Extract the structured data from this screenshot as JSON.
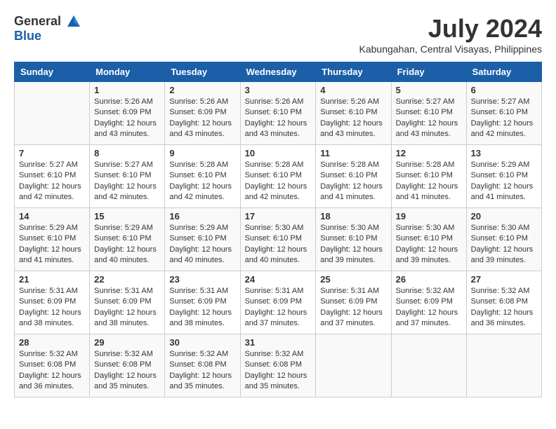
{
  "header": {
    "logo_general": "General",
    "logo_blue": "Blue",
    "title": "July 2024",
    "subtitle": "Kabungahan, Central Visayas, Philippines"
  },
  "calendar": {
    "days_of_week": [
      "Sunday",
      "Monday",
      "Tuesday",
      "Wednesday",
      "Thursday",
      "Friday",
      "Saturday"
    ],
    "weeks": [
      [
        {
          "day": "",
          "sunrise": "",
          "sunset": "",
          "daylight": ""
        },
        {
          "day": "1",
          "sunrise": "Sunrise: 5:26 AM",
          "sunset": "Sunset: 6:09 PM",
          "daylight": "Daylight: 12 hours and 43 minutes."
        },
        {
          "day": "2",
          "sunrise": "Sunrise: 5:26 AM",
          "sunset": "Sunset: 6:09 PM",
          "daylight": "Daylight: 12 hours and 43 minutes."
        },
        {
          "day": "3",
          "sunrise": "Sunrise: 5:26 AM",
          "sunset": "Sunset: 6:10 PM",
          "daylight": "Daylight: 12 hours and 43 minutes."
        },
        {
          "day": "4",
          "sunrise": "Sunrise: 5:26 AM",
          "sunset": "Sunset: 6:10 PM",
          "daylight": "Daylight: 12 hours and 43 minutes."
        },
        {
          "day": "5",
          "sunrise": "Sunrise: 5:27 AM",
          "sunset": "Sunset: 6:10 PM",
          "daylight": "Daylight: 12 hours and 43 minutes."
        },
        {
          "day": "6",
          "sunrise": "Sunrise: 5:27 AM",
          "sunset": "Sunset: 6:10 PM",
          "daylight": "Daylight: 12 hours and 42 minutes."
        }
      ],
      [
        {
          "day": "7",
          "sunrise": "Sunrise: 5:27 AM",
          "sunset": "Sunset: 6:10 PM",
          "daylight": "Daylight: 12 hours and 42 minutes."
        },
        {
          "day": "8",
          "sunrise": "Sunrise: 5:27 AM",
          "sunset": "Sunset: 6:10 PM",
          "daylight": "Daylight: 12 hours and 42 minutes."
        },
        {
          "day": "9",
          "sunrise": "Sunrise: 5:28 AM",
          "sunset": "Sunset: 6:10 PM",
          "daylight": "Daylight: 12 hours and 42 minutes."
        },
        {
          "day": "10",
          "sunrise": "Sunrise: 5:28 AM",
          "sunset": "Sunset: 6:10 PM",
          "daylight": "Daylight: 12 hours and 42 minutes."
        },
        {
          "day": "11",
          "sunrise": "Sunrise: 5:28 AM",
          "sunset": "Sunset: 6:10 PM",
          "daylight": "Daylight: 12 hours and 41 minutes."
        },
        {
          "day": "12",
          "sunrise": "Sunrise: 5:28 AM",
          "sunset": "Sunset: 6:10 PM",
          "daylight": "Daylight: 12 hours and 41 minutes."
        },
        {
          "day": "13",
          "sunrise": "Sunrise: 5:29 AM",
          "sunset": "Sunset: 6:10 PM",
          "daylight": "Daylight: 12 hours and 41 minutes."
        }
      ],
      [
        {
          "day": "14",
          "sunrise": "Sunrise: 5:29 AM",
          "sunset": "Sunset: 6:10 PM",
          "daylight": "Daylight: 12 hours and 41 minutes."
        },
        {
          "day": "15",
          "sunrise": "Sunrise: 5:29 AM",
          "sunset": "Sunset: 6:10 PM",
          "daylight": "Daylight: 12 hours and 40 minutes."
        },
        {
          "day": "16",
          "sunrise": "Sunrise: 5:29 AM",
          "sunset": "Sunset: 6:10 PM",
          "daylight": "Daylight: 12 hours and 40 minutes."
        },
        {
          "day": "17",
          "sunrise": "Sunrise: 5:30 AM",
          "sunset": "Sunset: 6:10 PM",
          "daylight": "Daylight: 12 hours and 40 minutes."
        },
        {
          "day": "18",
          "sunrise": "Sunrise: 5:30 AM",
          "sunset": "Sunset: 6:10 PM",
          "daylight": "Daylight: 12 hours and 39 minutes."
        },
        {
          "day": "19",
          "sunrise": "Sunrise: 5:30 AM",
          "sunset": "Sunset: 6:10 PM",
          "daylight": "Daylight: 12 hours and 39 minutes."
        },
        {
          "day": "20",
          "sunrise": "Sunrise: 5:30 AM",
          "sunset": "Sunset: 6:10 PM",
          "daylight": "Daylight: 12 hours and 39 minutes."
        }
      ],
      [
        {
          "day": "21",
          "sunrise": "Sunrise: 5:31 AM",
          "sunset": "Sunset: 6:09 PM",
          "daylight": "Daylight: 12 hours and 38 minutes."
        },
        {
          "day": "22",
          "sunrise": "Sunrise: 5:31 AM",
          "sunset": "Sunset: 6:09 PM",
          "daylight": "Daylight: 12 hours and 38 minutes."
        },
        {
          "day": "23",
          "sunrise": "Sunrise: 5:31 AM",
          "sunset": "Sunset: 6:09 PM",
          "daylight": "Daylight: 12 hours and 38 minutes."
        },
        {
          "day": "24",
          "sunrise": "Sunrise: 5:31 AM",
          "sunset": "Sunset: 6:09 PM",
          "daylight": "Daylight: 12 hours and 37 minutes."
        },
        {
          "day": "25",
          "sunrise": "Sunrise: 5:31 AM",
          "sunset": "Sunset: 6:09 PM",
          "daylight": "Daylight: 12 hours and 37 minutes."
        },
        {
          "day": "26",
          "sunrise": "Sunrise: 5:32 AM",
          "sunset": "Sunset: 6:09 PM",
          "daylight": "Daylight: 12 hours and 37 minutes."
        },
        {
          "day": "27",
          "sunrise": "Sunrise: 5:32 AM",
          "sunset": "Sunset: 6:08 PM",
          "daylight": "Daylight: 12 hours and 36 minutes."
        }
      ],
      [
        {
          "day": "28",
          "sunrise": "Sunrise: 5:32 AM",
          "sunset": "Sunset: 6:08 PM",
          "daylight": "Daylight: 12 hours and 36 minutes."
        },
        {
          "day": "29",
          "sunrise": "Sunrise: 5:32 AM",
          "sunset": "Sunset: 6:08 PM",
          "daylight": "Daylight: 12 hours and 35 minutes."
        },
        {
          "day": "30",
          "sunrise": "Sunrise: 5:32 AM",
          "sunset": "Sunset: 6:08 PM",
          "daylight": "Daylight: 12 hours and 35 minutes."
        },
        {
          "day": "31",
          "sunrise": "Sunrise: 5:32 AM",
          "sunset": "Sunset: 6:08 PM",
          "daylight": "Daylight: 12 hours and 35 minutes."
        },
        {
          "day": "",
          "sunrise": "",
          "sunset": "",
          "daylight": ""
        },
        {
          "day": "",
          "sunrise": "",
          "sunset": "",
          "daylight": ""
        },
        {
          "day": "",
          "sunrise": "",
          "sunset": "",
          "daylight": ""
        }
      ]
    ]
  }
}
